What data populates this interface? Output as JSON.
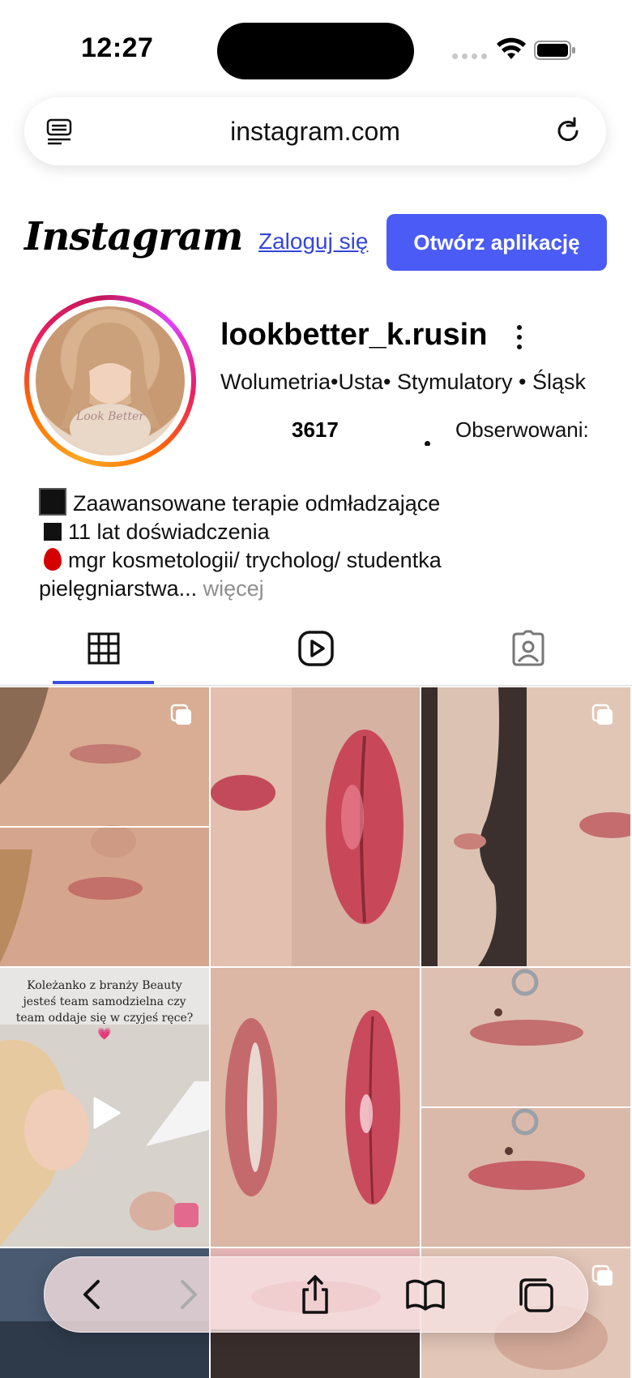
{
  "status_bar": {
    "time": "12:27"
  },
  "browser": {
    "url": "instagram.com"
  },
  "header": {
    "logo": "Instagram",
    "login_label": "Zaloguj się",
    "open_app_label": "Otwórz aplikację",
    "accent_color": "#4a5cf5"
  },
  "profile": {
    "username": "lookbetter_k.rusin",
    "bio_line": "Wolumetria•Usta• Stymulatory • Śląsk",
    "stats": {
      "posts_value": "3617",
      "following_label": "Obserwowani:"
    },
    "bio": {
      "line1": "Zaawansowane terapie odmładzające",
      "line2": "11 lat doświadczenia",
      "line3": "mgr kosmetologii/ trycholog/ studentka",
      "line4": "pielęgniarstwa...",
      "more_label": "więcej"
    }
  },
  "tabs": [
    {
      "icon": "grid-icon",
      "active": true
    },
    {
      "icon": "reels-icon",
      "active": false
    },
    {
      "icon": "tagged-icon",
      "active": false
    }
  ],
  "posts": [
    {
      "type": "carousel"
    },
    {
      "type": "image"
    },
    {
      "type": "carousel"
    },
    {
      "type": "reel",
      "caption": "Koleżanko z branży Beauty jesteś team samodzielna czy team oddaje się w czyjeś ręce? 💗"
    },
    {
      "type": "image"
    },
    {
      "type": "image"
    }
  ],
  "toolbar": {
    "buttons": [
      "back-icon",
      "forward-icon",
      "share-icon",
      "bookmarks-icon",
      "tabs-icon"
    ]
  }
}
